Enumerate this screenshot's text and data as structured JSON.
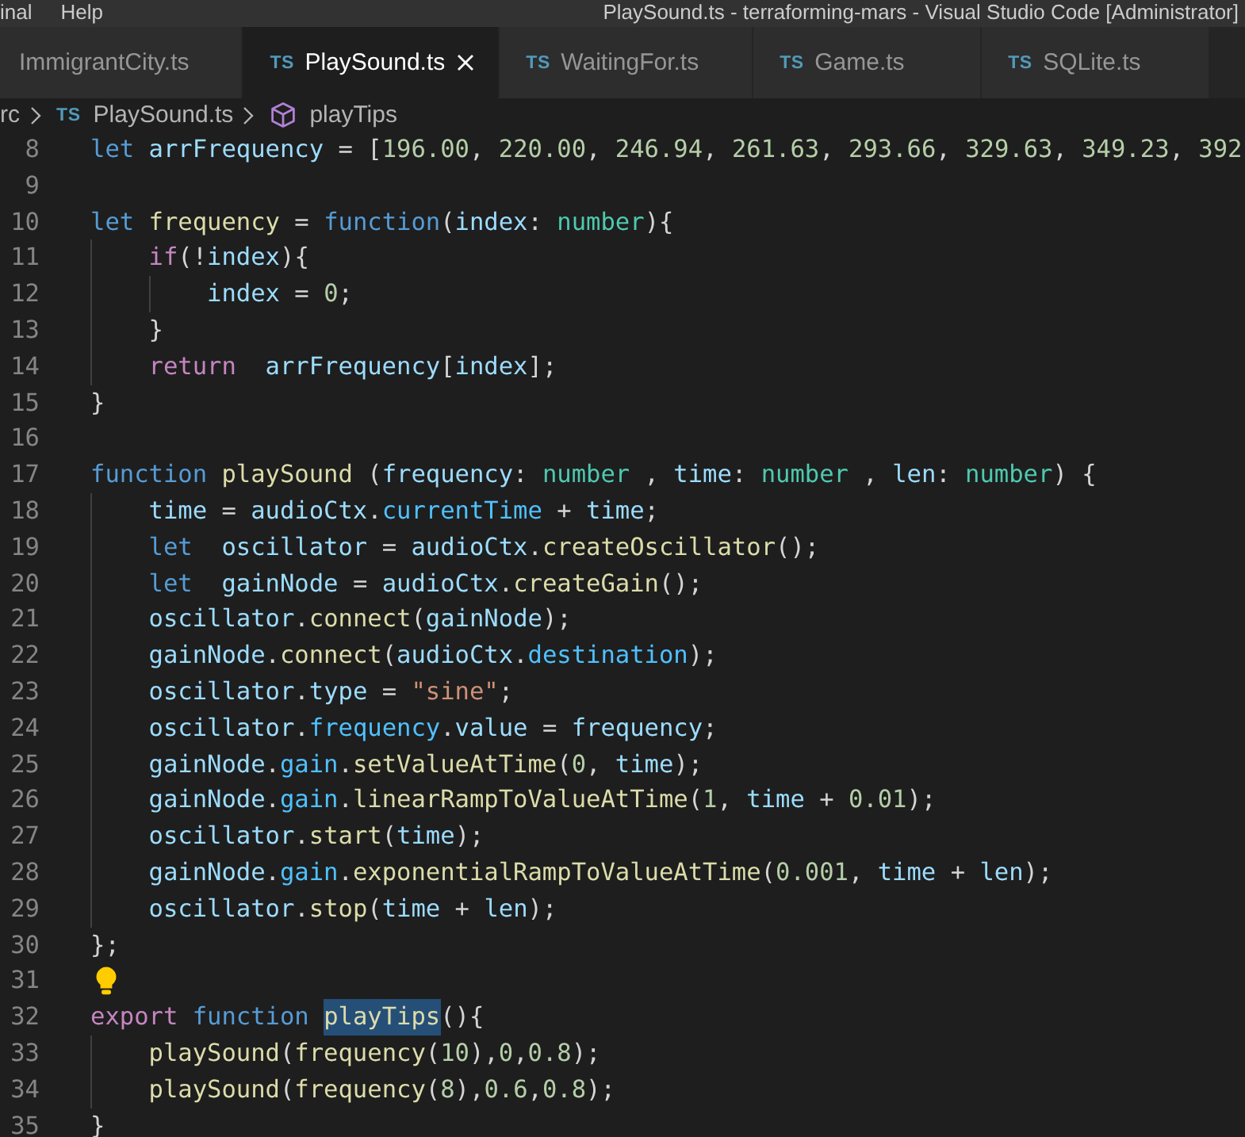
{
  "title_bar": {
    "menu": [
      "inal",
      "Help"
    ],
    "title": "PlaySound.ts - terraforming-mars - Visual Studio Code [Administrator]"
  },
  "tabs": [
    {
      "label": "ImmigrantCity.ts",
      "selected": false
    },
    {
      "icon_text": "TS",
      "label": "PlaySound.ts",
      "selected": true
    },
    {
      "icon_text": "TS",
      "label": "WaitingFor.ts",
      "selected": false
    },
    {
      "icon_text": "TS",
      "label": "Game.ts",
      "selected": false
    },
    {
      "icon_text": "TS",
      "label": "SQLite.ts",
      "selected": false
    }
  ],
  "breadcrumb": [
    {
      "kind": "folder",
      "label": "rc"
    },
    {
      "kind": "file",
      "icon_text": "TS",
      "label": "PlaySound.ts"
    },
    {
      "kind": "symbol",
      "label": "playTips"
    }
  ],
  "editor": {
    "lines": [
      {
        "number": "8",
        "lightbulb": false,
        "tokens": [
          {
            "text": "let ",
            "kind": "keyword"
          },
          {
            "text": "arrFrequency",
            "kind": "variable"
          },
          {
            "text": " = [",
            "kind": "plain"
          },
          {
            "text": "196.00",
            "kind": "number"
          },
          {
            "text": ", ",
            "kind": "plain"
          },
          {
            "text": "220.00",
            "kind": "number"
          },
          {
            "text": ", ",
            "kind": "plain"
          },
          {
            "text": "246.94",
            "kind": "number"
          },
          {
            "text": ", ",
            "kind": "plain"
          },
          {
            "text": "261.63",
            "kind": "number"
          },
          {
            "text": ", ",
            "kind": "plain"
          },
          {
            "text": "293.66",
            "kind": "number"
          },
          {
            "text": ", ",
            "kind": "plain"
          },
          {
            "text": "329.63",
            "kind": "number"
          },
          {
            "text": ", ",
            "kind": "plain"
          },
          {
            "text": "349.23",
            "kind": "number"
          },
          {
            "text": ", ",
            "kind": "plain"
          },
          {
            "text": "392",
            "kind": "number"
          }
        ]
      },
      {
        "number": "9",
        "lightbulb": false
      },
      {
        "number": "10",
        "lightbulb": false,
        "tokens": [
          {
            "text": "let ",
            "kind": "keyword"
          },
          {
            "text": "frequency",
            "kind": "function"
          },
          {
            "text": " = ",
            "kind": "plain"
          },
          {
            "text": "function",
            "kind": "keyword"
          },
          {
            "text": "(",
            "kind": "plain"
          },
          {
            "text": "index",
            "kind": "variable"
          },
          {
            "text": ": ",
            "kind": "plain"
          },
          {
            "text": "number",
            "kind": "type"
          },
          {
            "text": "){",
            "kind": "plain"
          }
        ],
        "children": [
          {
            "number": "11",
            "lightbulb": false,
            "tokens": [
              {
                "text": "if",
                "kind": "control"
              },
              {
                "text": "(!",
                "kind": "plain"
              },
              {
                "text": "index",
                "kind": "variable"
              },
              {
                "text": "){",
                "kind": "plain"
              }
            ],
            "children": [
              {
                "number": "12",
                "lightbulb": false,
                "tokens": [
                  {
                    "text": "index",
                    "kind": "variable"
                  },
                  {
                    "text": " = ",
                    "kind": "plain"
                  },
                  {
                    "text": "0",
                    "kind": "number"
                  },
                  {
                    "text": ";",
                    "kind": "plain"
                  }
                ]
              }
            ]
          },
          {
            "number": "13",
            "lightbulb": false,
            "tokens": [
              {
                "text": "}",
                "kind": "plain"
              }
            ]
          },
          {
            "number": "14",
            "lightbulb": false,
            "tokens": [
              {
                "text": "return  ",
                "kind": "control"
              },
              {
                "text": "arrFrequency",
                "kind": "variable"
              },
              {
                "text": "[",
                "kind": "plain"
              },
              {
                "text": "index",
                "kind": "variable"
              },
              {
                "text": "];",
                "kind": "plain"
              }
            ]
          }
        ]
      },
      {
        "number": "15",
        "lightbulb": false,
        "tokens": [
          {
            "text": "}",
            "kind": "plain"
          }
        ]
      },
      {
        "number": "16",
        "lightbulb": false
      },
      {
        "number": "17",
        "lightbulb": false,
        "tokens": [
          {
            "text": "function ",
            "kind": "keyword"
          },
          {
            "text": "playSound",
            "kind": "function"
          },
          {
            "text": " (",
            "kind": "plain"
          },
          {
            "text": "frequency",
            "kind": "variable"
          },
          {
            "text": ": ",
            "kind": "plain"
          },
          {
            "text": "number",
            "kind": "type"
          },
          {
            "text": " , ",
            "kind": "plain"
          },
          {
            "text": "time",
            "kind": "variable"
          },
          {
            "text": ": ",
            "kind": "plain"
          },
          {
            "text": "number",
            "kind": "type"
          },
          {
            "text": " , ",
            "kind": "plain"
          },
          {
            "text": "len",
            "kind": "variable"
          },
          {
            "text": ": ",
            "kind": "plain"
          },
          {
            "text": "number",
            "kind": "type"
          },
          {
            "text": ") {",
            "kind": "plain"
          }
        ],
        "children": [
          {
            "number": "18",
            "lightbulb": false,
            "tokens": [
              {
                "text": "time",
                "kind": "variable"
              },
              {
                "text": " = ",
                "kind": "plain"
              },
              {
                "text": "audioCtx",
                "kind": "variable"
              },
              {
                "text": ".",
                "kind": "plain"
              },
              {
                "text": "currentTime",
                "kind": "property"
              },
              {
                "text": " + ",
                "kind": "plain"
              },
              {
                "text": "time",
                "kind": "variable"
              },
              {
                "text": ";",
                "kind": "plain"
              }
            ]
          },
          {
            "number": "19",
            "lightbulb": false,
            "tokens": [
              {
                "text": "let  ",
                "kind": "keyword"
              },
              {
                "text": "oscillator",
                "kind": "variable"
              },
              {
                "text": " = ",
                "kind": "plain"
              },
              {
                "text": "audioCtx",
                "kind": "variable"
              },
              {
                "text": ".",
                "kind": "plain"
              },
              {
                "text": "createOscillator",
                "kind": "function"
              },
              {
                "text": "();",
                "kind": "plain"
              }
            ]
          },
          {
            "number": "20",
            "lightbulb": false,
            "tokens": [
              {
                "text": "let  ",
                "kind": "keyword"
              },
              {
                "text": "gainNode",
                "kind": "variable"
              },
              {
                "text": " = ",
                "kind": "plain"
              },
              {
                "text": "audioCtx",
                "kind": "variable"
              },
              {
                "text": ".",
                "kind": "plain"
              },
              {
                "text": "createGain",
                "kind": "function"
              },
              {
                "text": "();",
                "kind": "plain"
              }
            ]
          },
          {
            "number": "21",
            "lightbulb": false,
            "tokens": [
              {
                "text": "oscillator",
                "kind": "variable"
              },
              {
                "text": ".",
                "kind": "plain"
              },
              {
                "text": "connect",
                "kind": "function"
              },
              {
                "text": "(",
                "kind": "plain"
              },
              {
                "text": "gainNode",
                "kind": "variable"
              },
              {
                "text": ");",
                "kind": "plain"
              }
            ]
          },
          {
            "number": "22",
            "lightbulb": false,
            "tokens": [
              {
                "text": "gainNode",
                "kind": "variable"
              },
              {
                "text": ".",
                "kind": "plain"
              },
              {
                "text": "connect",
                "kind": "function"
              },
              {
                "text": "(",
                "kind": "plain"
              },
              {
                "text": "audioCtx",
                "kind": "variable"
              },
              {
                "text": ".",
                "kind": "plain"
              },
              {
                "text": "destination",
                "kind": "property"
              },
              {
                "text": ");",
                "kind": "plain"
              }
            ]
          },
          {
            "number": "23",
            "lightbulb": false,
            "tokens": [
              {
                "text": "oscillator",
                "kind": "variable"
              },
              {
                "text": ".",
                "kind": "plain"
              },
              {
                "text": "type",
                "kind": "variable"
              },
              {
                "text": " = ",
                "kind": "plain"
              },
              {
                "text": "\"sine\"",
                "kind": "string"
              },
              {
                "text": ";",
                "kind": "plain"
              }
            ]
          },
          {
            "number": "24",
            "lightbulb": false,
            "tokens": [
              {
                "text": "oscillator",
                "kind": "variable"
              },
              {
                "text": ".",
                "kind": "plain"
              },
              {
                "text": "frequency",
                "kind": "property"
              },
              {
                "text": ".",
                "kind": "plain"
              },
              {
                "text": "value",
                "kind": "variable"
              },
              {
                "text": " = ",
                "kind": "plain"
              },
              {
                "text": "frequency",
                "kind": "variable"
              },
              {
                "text": ";",
                "kind": "plain"
              }
            ]
          },
          {
            "number": "25",
            "lightbulb": false,
            "tokens": [
              {
                "text": "gainNode",
                "kind": "variable"
              },
              {
                "text": ".",
                "kind": "plain"
              },
              {
                "text": "gain",
                "kind": "property"
              },
              {
                "text": ".",
                "kind": "plain"
              },
              {
                "text": "setValueAtTime",
                "kind": "function"
              },
              {
                "text": "(",
                "kind": "plain"
              },
              {
                "text": "0",
                "kind": "number"
              },
              {
                "text": ", ",
                "kind": "plain"
              },
              {
                "text": "time",
                "kind": "variable"
              },
              {
                "text": ");",
                "kind": "plain"
              }
            ]
          },
          {
            "number": "26",
            "lightbulb": false,
            "tokens": [
              {
                "text": "gainNode",
                "kind": "variable"
              },
              {
                "text": ".",
                "kind": "plain"
              },
              {
                "text": "gain",
                "kind": "property"
              },
              {
                "text": ".",
                "kind": "plain"
              },
              {
                "text": "linearRampToValueAtTime",
                "kind": "function"
              },
              {
                "text": "(",
                "kind": "plain"
              },
              {
                "text": "1",
                "kind": "number"
              },
              {
                "text": ", ",
                "kind": "plain"
              },
              {
                "text": "time",
                "kind": "variable"
              },
              {
                "text": " + ",
                "kind": "plain"
              },
              {
                "text": "0.01",
                "kind": "number"
              },
              {
                "text": ");",
                "kind": "plain"
              }
            ]
          },
          {
            "number": "27",
            "lightbulb": false,
            "tokens": [
              {
                "text": "oscillator",
                "kind": "variable"
              },
              {
                "text": ".",
                "kind": "plain"
              },
              {
                "text": "start",
                "kind": "function"
              },
              {
                "text": "(",
                "kind": "plain"
              },
              {
                "text": "time",
                "kind": "variable"
              },
              {
                "text": ");",
                "kind": "plain"
              }
            ]
          },
          {
            "number": "28",
            "lightbulb": false,
            "tokens": [
              {
                "text": "gainNode",
                "kind": "variable"
              },
              {
                "text": ".",
                "kind": "plain"
              },
              {
                "text": "gain",
                "kind": "property"
              },
              {
                "text": ".",
                "kind": "plain"
              },
              {
                "text": "exponentialRampToValueAtTime",
                "kind": "function"
              },
              {
                "text": "(",
                "kind": "plain"
              },
              {
                "text": "0.001",
                "kind": "number"
              },
              {
                "text": ", ",
                "kind": "plain"
              },
              {
                "text": "time",
                "kind": "variable"
              },
              {
                "text": " + ",
                "kind": "plain"
              },
              {
                "text": "len",
                "kind": "variable"
              },
              {
                "text": ");",
                "kind": "plain"
              }
            ]
          },
          {
            "number": "29",
            "lightbulb": false,
            "tokens": [
              {
                "text": "oscillator",
                "kind": "variable"
              },
              {
                "text": ".",
                "kind": "plain"
              },
              {
                "text": "stop",
                "kind": "function"
              },
              {
                "text": "(",
                "kind": "plain"
              },
              {
                "text": "time",
                "kind": "variable"
              },
              {
                "text": " + ",
                "kind": "plain"
              },
              {
                "text": "len",
                "kind": "variable"
              },
              {
                "text": ");",
                "kind": "plain"
              }
            ]
          }
        ]
      },
      {
        "number": "30",
        "lightbulb": false,
        "tokens": [
          {
            "text": "};",
            "kind": "plain"
          }
        ]
      },
      {
        "number": "31",
        "lightbulb": true
      },
      {
        "number": "32",
        "lightbulb": false,
        "tokens": [
          {
            "text": "export ",
            "kind": "control",
            "highlighted": false
          },
          {
            "text": "function ",
            "kind": "keyword",
            "highlighted": false
          },
          {
            "text": "playTips",
            "kind": "function",
            "highlighted": true
          },
          {
            "text": "(){",
            "kind": "plain",
            "highlighted": false
          }
        ],
        "children": [
          {
            "number": "33",
            "lightbulb": false,
            "tokens": [
              {
                "text": "playSound",
                "kind": "function"
              },
              {
                "text": "(",
                "kind": "plain"
              },
              {
                "text": "frequency",
                "kind": "function"
              },
              {
                "text": "(",
                "kind": "plain"
              },
              {
                "text": "10",
                "kind": "number"
              },
              {
                "text": "),",
                "kind": "plain"
              },
              {
                "text": "0",
                "kind": "number"
              },
              {
                "text": ",",
                "kind": "plain"
              },
              {
                "text": "0.8",
                "kind": "number"
              },
              {
                "text": ");",
                "kind": "plain"
              }
            ]
          },
          {
            "number": "34",
            "lightbulb": false,
            "tokens": [
              {
                "text": "playSound",
                "kind": "function"
              },
              {
                "text": "(",
                "kind": "plain"
              },
              {
                "text": "frequency",
                "kind": "function"
              },
              {
                "text": "(",
                "kind": "plain"
              },
              {
                "text": "8",
                "kind": "number"
              },
              {
                "text": "),",
                "kind": "plain"
              },
              {
                "text": "0.6",
                "kind": "number"
              },
              {
                "text": ",",
                "kind": "plain"
              },
              {
                "text": "0.8",
                "kind": "number"
              },
              {
                "text": ");",
                "kind": "plain"
              }
            ]
          }
        ]
      },
      {
        "number": "35",
        "lightbulb": false,
        "tokens": [
          {
            "text": "}",
            "kind": "plain"
          }
        ]
      }
    ]
  }
}
